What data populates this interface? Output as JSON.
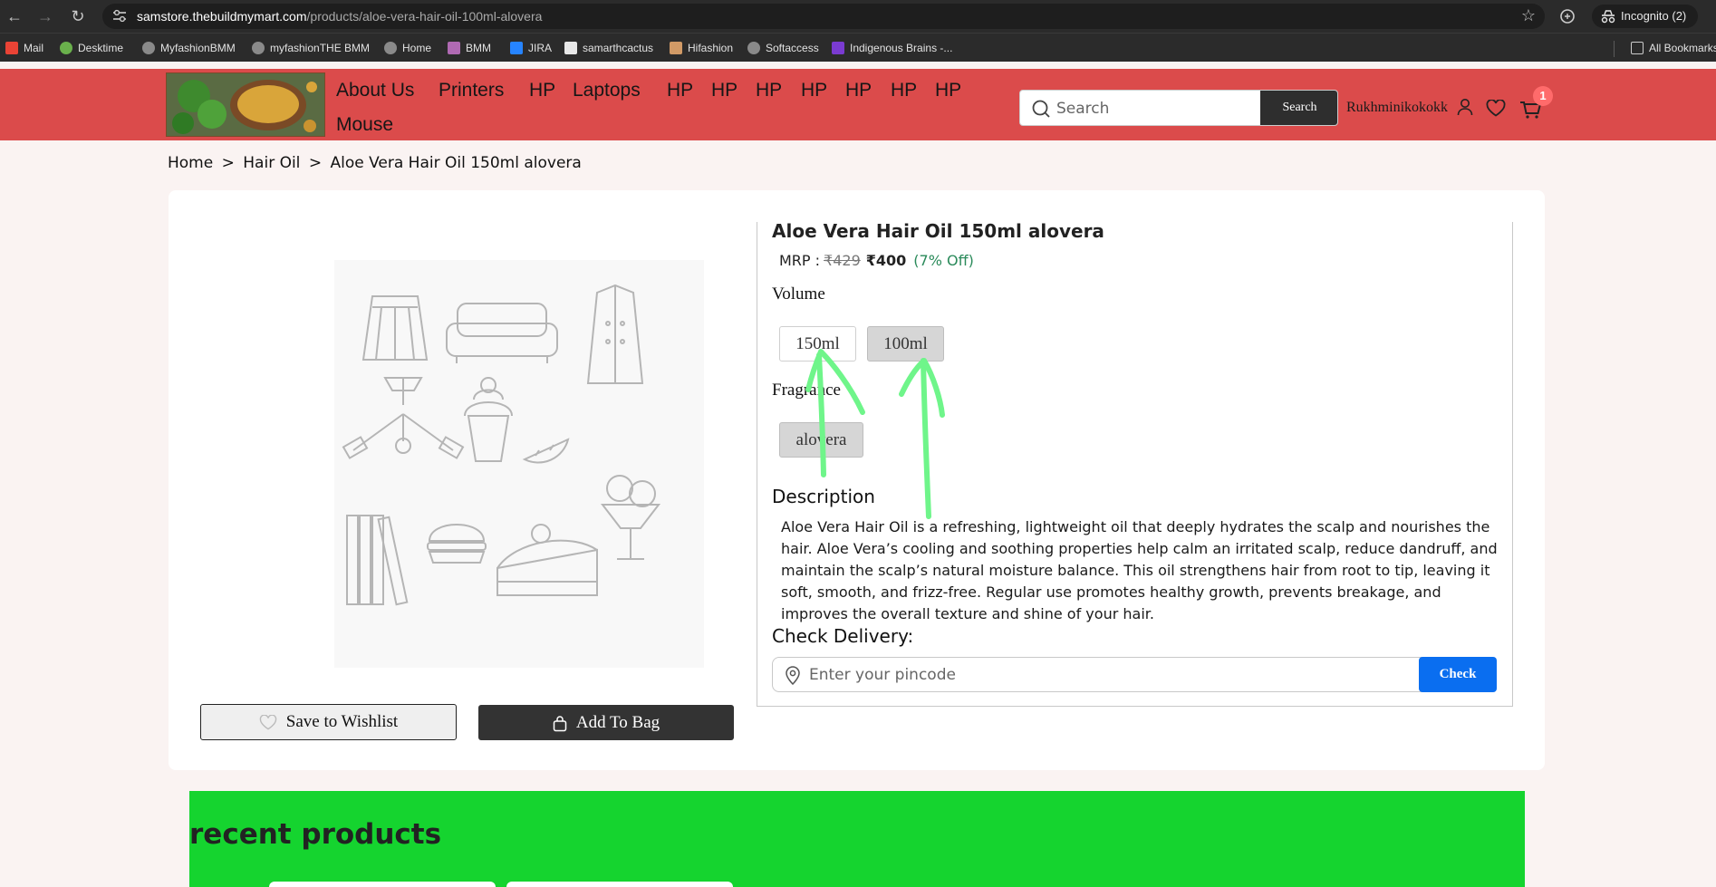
{
  "browser": {
    "url_host": "samstore.thebuildmymart.com",
    "url_path": "/products/aloe-vera-hair-oil-100ml-alovera",
    "incognito_label": "Incognito (2)",
    "bookmarks": [
      "Mail",
      "Desktime",
      "MyfashionBMM",
      "myfashionTHE BMM",
      "Home",
      "BMM",
      "JIRA",
      "samarthcactus",
      "Hifashion",
      "Softaccess",
      "Indigenous Brains -...",
      "All Bookmarks"
    ]
  },
  "header": {
    "menu": [
      "About Us",
      "Printers",
      "HP",
      "Laptops",
      "HP",
      "HP",
      "HP",
      "HP",
      "HP",
      "HP",
      "HP",
      "Mouse"
    ],
    "search_placeholder": "Search",
    "search_button": "Search",
    "username": "Rukhminikokokk",
    "cart_count": "1",
    "accent_color": "#db4b4b"
  },
  "breadcrumb": [
    "Home",
    ">",
    "Hair Oil",
    ">",
    "Aloe Vera Hair Oil 150ml alovera"
  ],
  "product": {
    "title": "Aloe Vera Hair Oil 150ml alovera",
    "mrp_label": "MRP :",
    "mrp_old": "₹429",
    "price": "₹400",
    "discount": "(7% Off)",
    "volume_label": "Volume",
    "volume_options": [
      "150ml",
      "100ml"
    ],
    "fragrance_label": "Fragrance",
    "fragrance_options": [
      "alovera"
    ],
    "description_title": "Description",
    "description": "Aloe Vera Hair Oil is a refreshing, lightweight oil that deeply hydrates the scalp and nourishes the hair. Aloe Vera’s cooling and soothing properties help calm an irritated scalp, reduce dandruff, and maintain the scalp’s natural moisture balance. This oil strengthens hair from root to tip, leaving it soft, smooth, and frizz-free. Regular use promotes healthy growth, prevents breakage, and improves the overall texture and shine of your hair.",
    "delivery_title": "Check Delivery:",
    "pincode_placeholder": "Enter your pincode",
    "check_button": "Check",
    "wishlist_button": "Save to Wishlist",
    "bag_button": "Add To Bag"
  },
  "recent": {
    "title": "recent products",
    "bg_color": "#15d42f"
  }
}
